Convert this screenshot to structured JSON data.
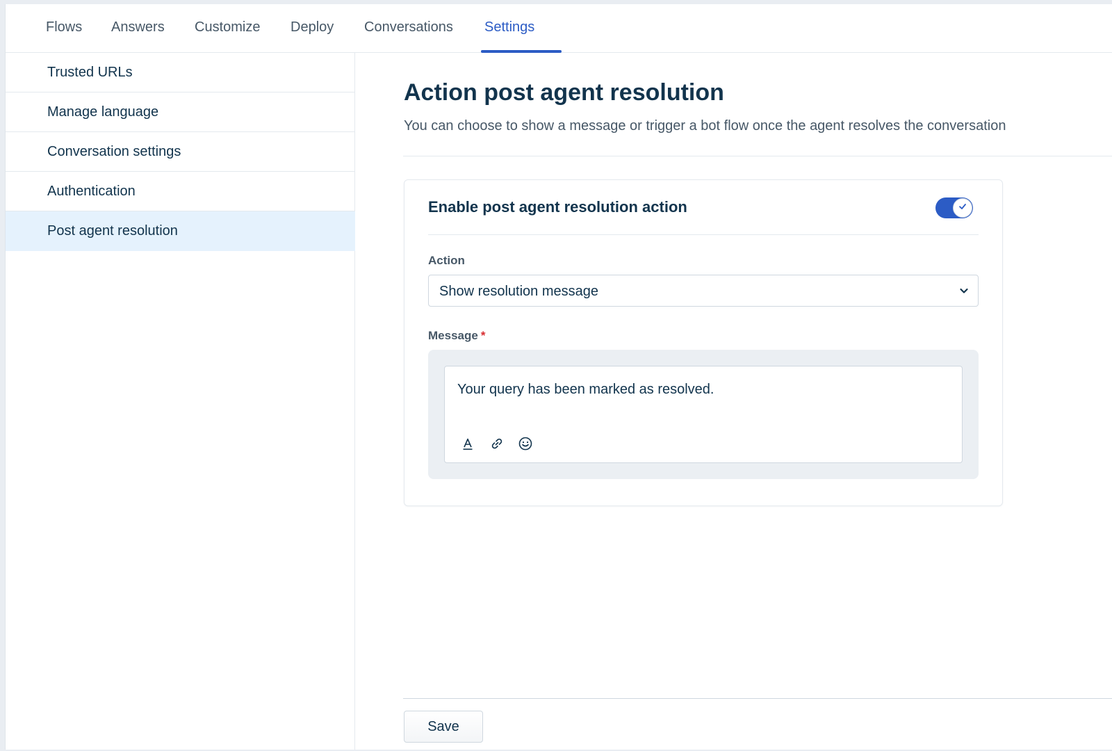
{
  "nav": {
    "tabs": [
      {
        "label": "Flows"
      },
      {
        "label": "Answers"
      },
      {
        "label": "Customize"
      },
      {
        "label": "Deploy"
      },
      {
        "label": "Conversations"
      },
      {
        "label": "Settings",
        "active": true
      }
    ]
  },
  "sidebar": {
    "items": [
      {
        "label": "Trusted URLs"
      },
      {
        "label": "Manage language"
      },
      {
        "label": "Conversation settings"
      },
      {
        "label": "Authentication"
      },
      {
        "label": "Post agent resolution",
        "selected": true
      }
    ]
  },
  "main": {
    "title": "Action post agent resolution",
    "description": "You can choose to show a message or trigger a bot flow once the agent resolves the conversation",
    "card": {
      "title": "Enable post agent resolution action",
      "toggle_on": true,
      "action_label": "Action",
      "action_value": "Show resolution message",
      "message_label": "Message",
      "required_mark": "*",
      "message_text": "Your query has been marked as resolved.",
      "toolbar_icons": [
        "text-format-icon",
        "link-icon",
        "emoji-icon"
      ]
    },
    "save_label": "Save"
  },
  "colors": {
    "accent": "#2c5cc5",
    "selected_bg": "#e5f2fd",
    "text_primary": "#12344d",
    "text_secondary": "#475867",
    "required": "#d72d30"
  }
}
